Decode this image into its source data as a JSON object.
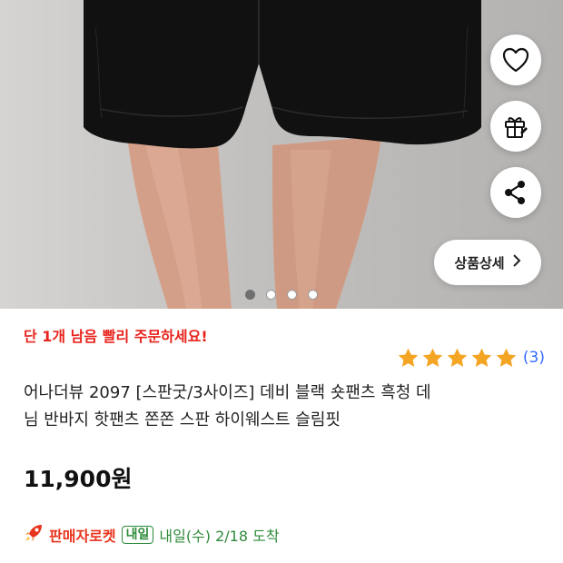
{
  "product_image": {
    "indicator_count": 4,
    "active_index": 0
  },
  "actions": {
    "like_icon": "heart-icon",
    "gift_icon": "gift-icon",
    "share_icon": "share-icon",
    "detail_label": "상품상세",
    "detail_icon": "chevron-right-icon"
  },
  "stock_alert": "단 1개 남음 빨리 주문하세요!",
  "rating": {
    "stars": 5,
    "count_label": "(3)",
    "star_color": "#f5a524"
  },
  "title_lines": [
    "어나더뷰 2097 [스판굿/3사이즈] 데비 블랙 숏팬츠 흑청 데",
    "님 반바지 핫팬츠 쫀쫀 스판 하이웨스트 슬림핏"
  ],
  "price": "11,900원",
  "delivery": {
    "seller_rocket": "판매자로켓",
    "badge": "내일",
    "arrival": "내일(수) 2/18 도착"
  },
  "colors": {
    "alert": "#e8231c",
    "rocket": "#e8321c",
    "arrival": "#2e8b3a",
    "link": "#346aff"
  }
}
